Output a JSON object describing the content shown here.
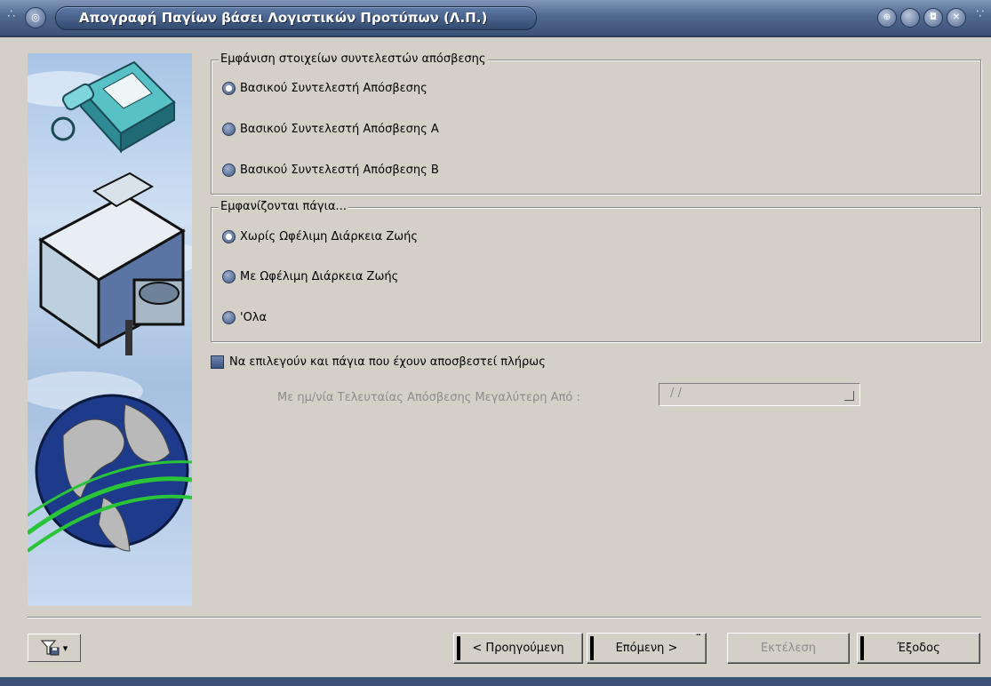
{
  "window": {
    "title": "Απογραφή Παγίων βάσει Λογιστικών Προτύπων (Λ.Π.)"
  },
  "depreciation_group": {
    "title": "Εμφάνιση στοιχείων συντελεστών απόσβεσης",
    "options": [
      {
        "label": "Βασικού Συντελεστή Απόσβεσης",
        "checked": true
      },
      {
        "label": "Βασικού Συντελεστή Απόσβεσης Α",
        "checked": false
      },
      {
        "label": "Βασικού Συντελεστή Απόσβεσης Β",
        "checked": false
      }
    ]
  },
  "assets_group": {
    "title": "Εμφανίζονται πάγια...",
    "options": [
      {
        "label": "Χωρίς Ωφέλιμη Διάρκεια Ζωής",
        "checked": true
      },
      {
        "label": "Με Ωφέλιμη Διάρκεια Ζωής",
        "checked": false
      },
      {
        "label": "'Ολα",
        "checked": false
      }
    ]
  },
  "fully_depreciated_checkbox": {
    "label": "Να επιλεγούν και πάγια που έχουν αποσβεστεί πλήρως"
  },
  "date_field": {
    "label": "Με ημ/νία Τελευταίας Απόσβεσης Μεγαλύτερη Από :",
    "value": " /  /"
  },
  "buttons": {
    "previous": "< Προηγούμενη",
    "next": "Επόμενη >",
    "execute": "Εκτέλεση",
    "exit": "Έξοδος"
  },
  "colors": {
    "title_bar": "#51688f",
    "window_bg": "#d4d0c8",
    "radio": "#3f5781"
  }
}
